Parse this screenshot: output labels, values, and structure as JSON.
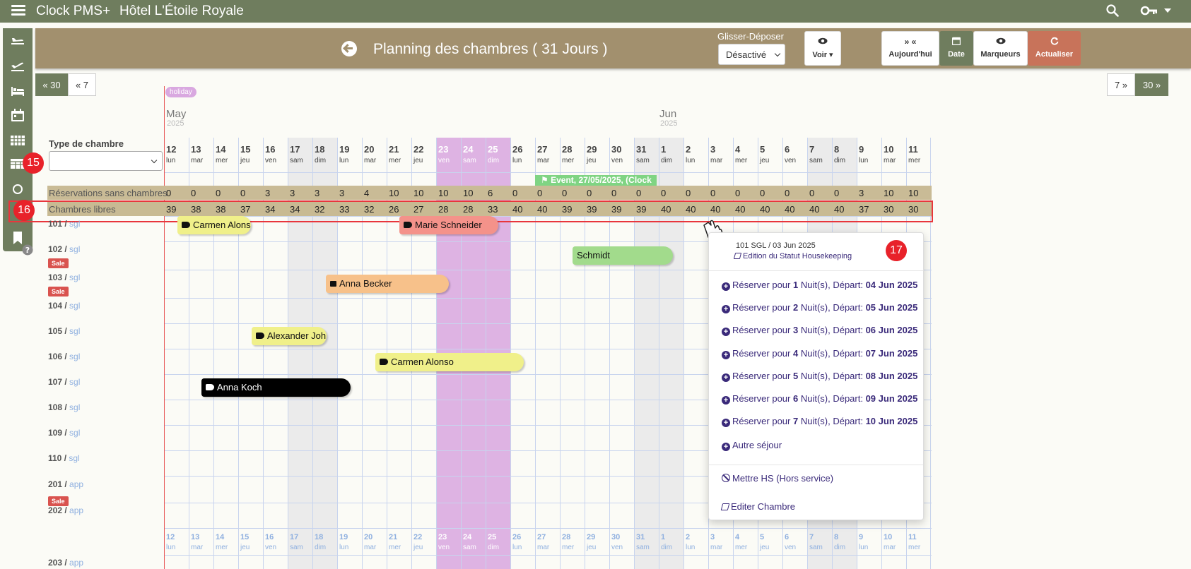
{
  "app": {
    "title": "Clock PMS+",
    "hotel": "Hôtel L'Étoile Royale"
  },
  "header": {
    "title": "Planning des chambres ( 31 Jours )",
    "drag_label": "Glisser-Déposer",
    "drag_value": "Désactivé",
    "voir_label": "Voir ▾",
    "today_glyph": "» «",
    "today_label": "Aujourd'hui",
    "date_label": "Date",
    "markers_label": "Marqueurs",
    "refresh_label": "Actualiser"
  },
  "nav": {
    "back30": "« 30",
    "back7": "« 7",
    "fwd7": "7 »",
    "fwd30": "30 »"
  },
  "calendar": {
    "holiday_label": "holiday",
    "month_may": "May",
    "year_may": "2025",
    "month_jun": "Jun",
    "year_jun": "2025",
    "room_type_label": "Type de chambre",
    "days": [
      {
        "d": "12",
        "n": "lun"
      },
      {
        "d": "13",
        "n": "mar"
      },
      {
        "d": "14",
        "n": "mer"
      },
      {
        "d": "15",
        "n": "jeu"
      },
      {
        "d": "16",
        "n": "ven"
      },
      {
        "d": "17",
        "n": "sam"
      },
      {
        "d": "18",
        "n": "dim"
      },
      {
        "d": "19",
        "n": "lun"
      },
      {
        "d": "20",
        "n": "mar"
      },
      {
        "d": "21",
        "n": "mer"
      },
      {
        "d": "22",
        "n": "jeu"
      },
      {
        "d": "23",
        "n": "ven"
      },
      {
        "d": "24",
        "n": "sam"
      },
      {
        "d": "25",
        "n": "dim"
      },
      {
        "d": "26",
        "n": "lun"
      },
      {
        "d": "27",
        "n": "mar"
      },
      {
        "d": "28",
        "n": "mer"
      },
      {
        "d": "29",
        "n": "jeu"
      },
      {
        "d": "30",
        "n": "ven"
      },
      {
        "d": "31",
        "n": "sam"
      },
      {
        "d": "1",
        "n": "dim"
      },
      {
        "d": "2",
        "n": "lun"
      },
      {
        "d": "3",
        "n": "mar"
      },
      {
        "d": "4",
        "n": "mer"
      },
      {
        "d": "5",
        "n": "jeu"
      },
      {
        "d": "6",
        "n": "ven"
      },
      {
        "d": "7",
        "n": "sam"
      },
      {
        "d": "8",
        "n": "dim"
      },
      {
        "d": "9",
        "n": "lun"
      },
      {
        "d": "10",
        "n": "mar"
      },
      {
        "d": "11",
        "n": "mer"
      }
    ],
    "weekend_cols": [
      5,
      6,
      19,
      20,
      26,
      27
    ],
    "holiday_cols": [
      11,
      12,
      13
    ],
    "event_label": "⚑ Event, 27/05/2025, (Clock",
    "unassigned_label": "Réservations sans chambres",
    "unassigned": [
      "0",
      "0",
      "0",
      "0",
      "3",
      "3",
      "3",
      "3",
      "4",
      "10",
      "10",
      "10",
      "10",
      "6",
      "0",
      "0",
      "0",
      "0",
      "0",
      "0",
      "0",
      "0",
      "0",
      "0",
      "0",
      "0",
      "0",
      "0",
      "3",
      "10",
      "10"
    ],
    "free_label": "Chambres libres",
    "free": [
      "39",
      "38",
      "38",
      "37",
      "34",
      "34",
      "32",
      "33",
      "32",
      "26",
      "27",
      "28",
      "28",
      "33",
      "40",
      "40",
      "39",
      "39",
      "39",
      "39",
      "40",
      "40",
      "40",
      "40",
      "40",
      "40",
      "40",
      "40",
      "37",
      "30",
      "30"
    ]
  },
  "rooms": [
    {
      "num": "101 /",
      "type": "sgl",
      "sale": ""
    },
    {
      "num": "102 /",
      "type": "sgl",
      "sale": "Sale"
    },
    {
      "num": "103 /",
      "type": "sgl",
      "sale": "Sale"
    },
    {
      "num": "104 /",
      "type": "sgl",
      "sale": ""
    },
    {
      "num": "105 /",
      "type": "sgl",
      "sale": ""
    },
    {
      "num": "106 /",
      "type": "sgl",
      "sale": ""
    },
    {
      "num": "107 /",
      "type": "sgl",
      "sale": ""
    },
    {
      "num": "108 /",
      "type": "sgl",
      "sale": ""
    },
    {
      "num": "109 /",
      "type": "sgl",
      "sale": ""
    },
    {
      "num": "110 /",
      "type": "sgl",
      "sale": ""
    },
    {
      "num": "201 /",
      "type": "app",
      "sale": "Sale"
    },
    {
      "num": "202 /",
      "type": "app",
      "sale": ""
    },
    {
      "num": "203 /",
      "type": "app",
      "sale": ""
    }
  ],
  "reservations": [
    {
      "name": "Carmen Alons",
      "room": "101",
      "color": "#f0f08a",
      "icon": "tag"
    },
    {
      "name": "Marie Schneider",
      "room": "101",
      "color": "#f4928a",
      "icon": "tag"
    },
    {
      "name": "Schmidt",
      "room": "102",
      "color": "#a2db8c",
      "icon": ""
    },
    {
      "name": "Anna Becker",
      "room": "103",
      "color": "#f7c18a",
      "icon": "lock"
    },
    {
      "name": "Alexander Joh",
      "room": "105",
      "color": "#f0f08a",
      "icon": "tag"
    },
    {
      "name": "Carmen Alonso",
      "room": "106",
      "color": "#f0f08a",
      "icon": "tag"
    },
    {
      "name": "Anna Koch",
      "room": "107",
      "color": "#000000",
      "icon": "tag"
    }
  ],
  "badges": {
    "b15": "15",
    "b16": "16",
    "b17": "17"
  },
  "popup": {
    "room": "101 SGL / 03 Jun 2025",
    "housekeeping": "Edition du Statut Housekeeping",
    "bookings": [
      {
        "pre": "Réserver pour ",
        "n": "1",
        "mid": " Nuit(s), Départ: ",
        "date": "04 Jun 2025"
      },
      {
        "pre": "Réserver pour ",
        "n": "2",
        "mid": " Nuit(s), Départ: ",
        "date": "05 Jun 2025"
      },
      {
        "pre": "Réserver pour ",
        "n": "3",
        "mid": " Nuit(s), Départ: ",
        "date": "06 Jun 2025"
      },
      {
        "pre": "Réserver pour ",
        "n": "4",
        "mid": " Nuit(s), Départ: ",
        "date": "07 Jun 2025"
      },
      {
        "pre": "Réserver pour ",
        "n": "5",
        "mid": " Nuit(s), Départ: ",
        "date": "08 Jun 2025"
      },
      {
        "pre": "Réserver pour ",
        "n": "6",
        "mid": " Nuit(s), Départ: ",
        "date": "09 Jun 2025"
      },
      {
        "pre": "Réserver pour ",
        "n": "7",
        "mid": " Nuit(s), Départ: ",
        "date": "10 Jun 2025"
      }
    ],
    "other_stay": "Autre séjour",
    "out_of_service": "Mettre HS (Hors service)",
    "edit_room": "Editer Chambre"
  },
  "colors": {
    "topbar": "#6f7d5e",
    "header": "#a2906e",
    "holiday": "#deb3e3",
    "refresh": "#c8735a",
    "today_line": "#e85656",
    "link": "#3a2a7a"
  }
}
